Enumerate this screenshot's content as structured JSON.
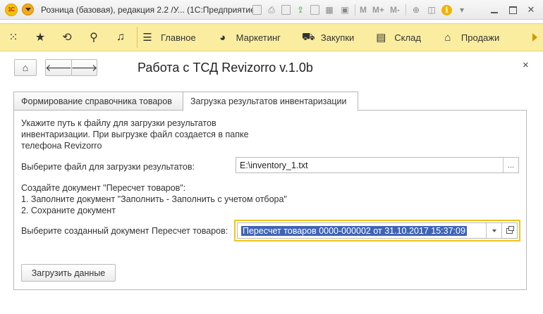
{
  "app": {
    "logo_text": "1С",
    "window_title": "Розница (базовая), редакция 2.2 /У...  (1С:Предприятие)",
    "toolbar_letters": [
      "M",
      "M+",
      "M-"
    ]
  },
  "sections": {
    "items": [
      {
        "label": "Главное",
        "icon": "menu-lines-icon"
      },
      {
        "label": "Маркетинг",
        "icon": "pie-chart-icon"
      },
      {
        "label": "Закупки",
        "icon": "cart-icon"
      },
      {
        "label": "Склад",
        "icon": "warehouse-icon"
      },
      {
        "label": "Продажи",
        "icon": "basket-icon"
      }
    ]
  },
  "form": {
    "title": "Работа с ТСД Revizorro v.1.0b",
    "close_label": "×",
    "tabs": [
      {
        "label": "Формирование справочника товаров",
        "active": false
      },
      {
        "label": "Загрузка результатов инвентаризации",
        "active": true
      }
    ],
    "info_lines": [
      "Укажите путь к файлу для загрузки результатов",
      "инвентаризации. При выгрузке файл создается в папке",
      "телефона Revizorro"
    ],
    "file_label": "Выберите файл для загрузки результатов:",
    "file_value": "E:\\inventory_1.txt",
    "file_button": "...",
    "steps": [
      "Создайте документ \"Пересчет товаров\":",
      "1. Заполните документ \"Заполнить - Заполнить с учетом отбора\"",
      "2. Сохраните документ"
    ],
    "doc_label": "Выберите созданный документ Пересчет товаров:",
    "doc_value": "Пересчет товаров 0000-000002 от 31.10.2017 15:37:09",
    "load_button": "Загрузить данные"
  },
  "colors": {
    "section_bar": "#fbeda0",
    "focus_border": "#f0c419",
    "selection": "#3f64b6"
  }
}
